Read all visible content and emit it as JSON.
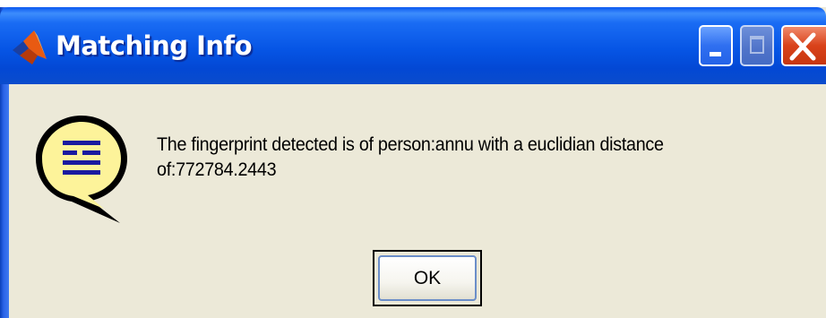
{
  "window": {
    "title": "Matching Info"
  },
  "titlebar_buttons": {
    "minimize": "minimize-icon",
    "maximize": "maximize-icon",
    "close": "close-icon"
  },
  "dialog": {
    "icon": "help-speech-bubble-icon",
    "message": "The fingerprint detected is of person:annu with a euclidian distance of:772784.2443",
    "ok_label": "OK"
  },
  "colors": {
    "titlebar": "#0655e5",
    "dialog_background": "#ece9d8",
    "close_button": "#d9421a",
    "icon_bubble": "#fdf39a"
  }
}
